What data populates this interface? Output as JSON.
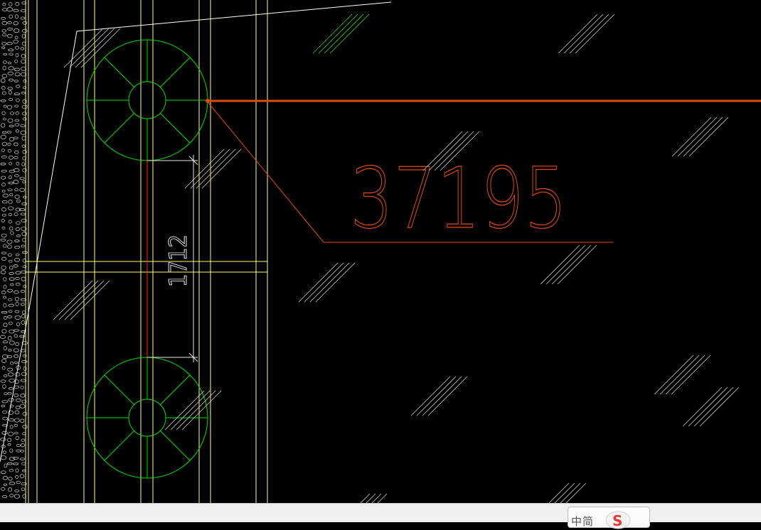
{
  "drawing": {
    "elevation_label": "37195",
    "dimension_label": "1712"
  },
  "colors": {
    "background": "#000000",
    "grid_yellow": "#ffff66",
    "circle_green": "#00e000",
    "leader_orange": "#e04a10",
    "dimension_white": "#e8e8e8",
    "hatch_white": "#cfcfcf",
    "hatch_green": "#2fcf2f"
  },
  "ime": {
    "mode_text": "中简",
    "logo_icon": "sogou-s-icon"
  }
}
